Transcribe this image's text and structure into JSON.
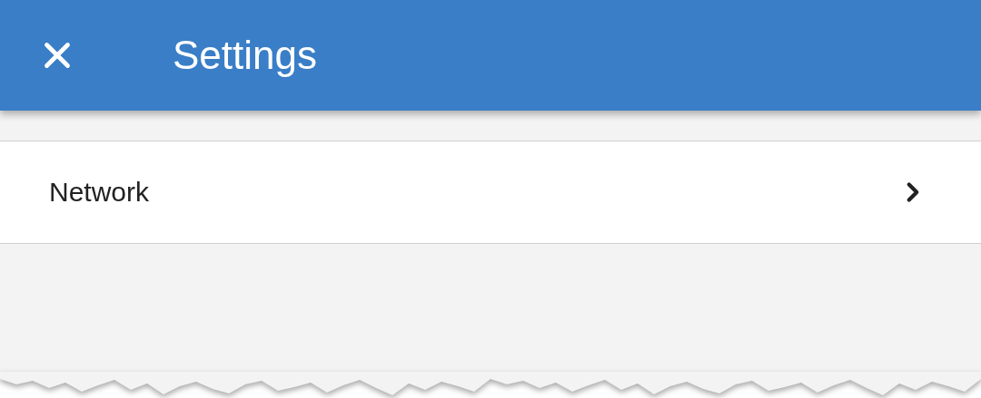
{
  "header": {
    "title": "Settings"
  },
  "items": [
    {
      "label": "Network"
    }
  ]
}
